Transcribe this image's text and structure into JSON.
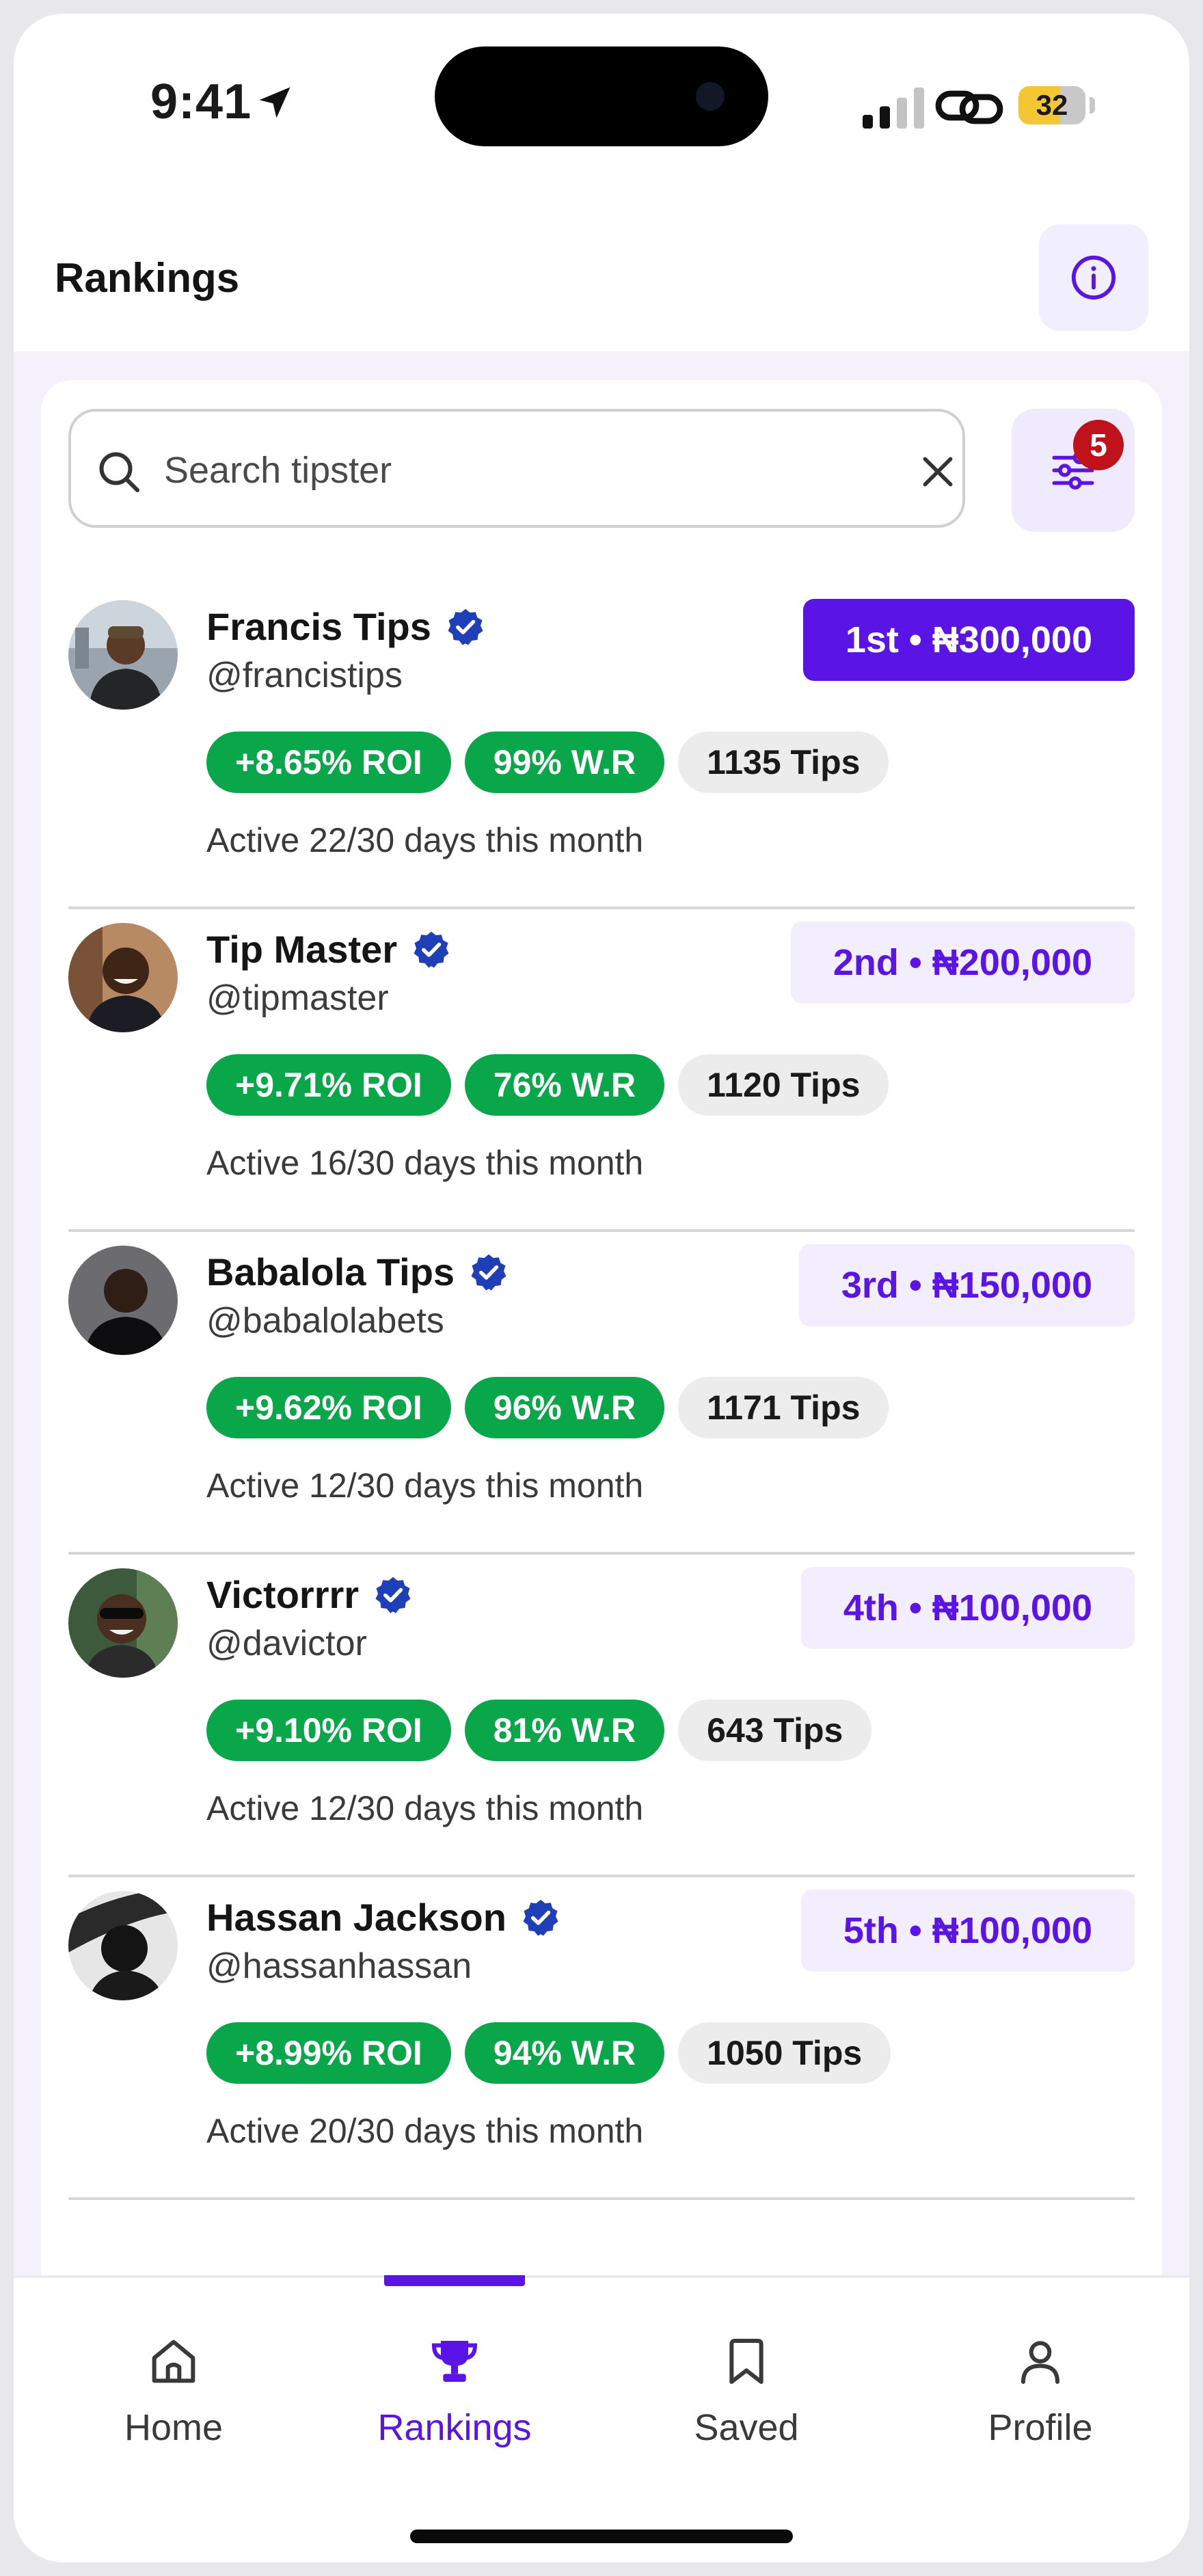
{
  "status_bar": {
    "time": "9:41",
    "battery": "32"
  },
  "header": {
    "title": "Rankings"
  },
  "search": {
    "placeholder": "Search tipster"
  },
  "filter": {
    "badge": "5"
  },
  "tipsters": [
    {
      "name": "Francis Tips",
      "handle": "@francistips",
      "rank": "1st • ₦300,000",
      "roi": "+8.65% ROI",
      "win_rate": "99% W.R",
      "tips": "1135 Tips",
      "activity": "Active 22/30 days this month"
    },
    {
      "name": "Tip Master",
      "handle": "@tipmaster",
      "rank": "2nd • ₦200,000",
      "roi": "+9.71% ROI",
      "win_rate": "76% W.R",
      "tips": "1120 Tips",
      "activity": "Active 16/30 days this month"
    },
    {
      "name": "Babalola Tips",
      "handle": "@babalolabets",
      "rank": "3rd • ₦150,000",
      "roi": "+9.62% ROI",
      "win_rate": "96% W.R",
      "tips": "1171 Tips",
      "activity": "Active 12/30 days this month"
    },
    {
      "name": "Victorrrr",
      "handle": "@davictor",
      "rank": "4th • ₦100,000",
      "roi": "+9.10% ROI",
      "win_rate": "81% W.R",
      "tips": "643 Tips",
      "activity": "Active 12/30 days this month"
    },
    {
      "name": "Hassan Jackson",
      "handle": "@hassanhassan",
      "rank": "5th • ₦100,000",
      "roi": "+8.99% ROI",
      "win_rate": "94% W.R",
      "tips": "1050 Tips",
      "activity": "Active 20/30 days this month"
    }
  ],
  "nav": {
    "items": [
      {
        "label": "Home",
        "icon": "home-icon"
      },
      {
        "label": "Rankings",
        "icon": "trophy-icon"
      },
      {
        "label": "Saved",
        "icon": "bookmark-icon"
      },
      {
        "label": "Profile",
        "icon": "profile-icon"
      }
    ],
    "active": "Rankings"
  },
  "colors": {
    "accent": "#5b14e6",
    "positive": "#0aa64a",
    "badge": "#c0121b",
    "verified": "#1f3fb8"
  }
}
